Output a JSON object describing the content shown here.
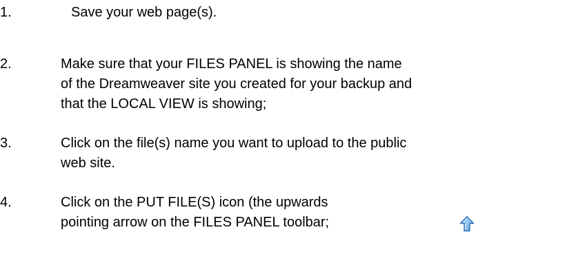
{
  "steps": [
    {
      "number": "1.",
      "lines": [
        "Save your web page(s)."
      ]
    },
    {
      "number": "2.",
      "lines": [
        "Make sure that your FILES PANEL is showing the name",
        "of the Dreamweaver site you created for your backup and",
        "that the LOCAL VIEW is showing;"
      ]
    },
    {
      "number": "3.",
      "lines": [
        "Click on the file(s) name you want to upload to the public",
        "web site."
      ]
    },
    {
      "number": "4.",
      "lines": [
        "Click on the PUT FILE(S) icon (the upwards",
        "pointing arrow on the FILES PANEL toolbar;"
      ]
    }
  ],
  "icons": {
    "put_file": "up-arrow-icon",
    "put_file_color": "#5fa0de"
  }
}
